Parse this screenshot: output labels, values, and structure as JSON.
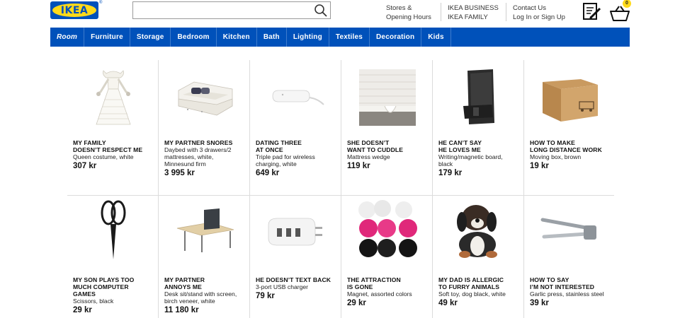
{
  "header": {
    "logo_text": "IKEA",
    "logo_reg": "®",
    "search_placeholder": "",
    "links": [
      {
        "line1": "Stores &",
        "line2": "Opening Hours"
      },
      {
        "line1": "IKEA BUSINESS",
        "line2": "IKEA FAMILY"
      },
      {
        "line1": "Contact Us",
        "line2": "Log In or Sign Up"
      }
    ],
    "cart_count": "0"
  },
  "nav": {
    "items": [
      "Room",
      "Furniture",
      "Storage",
      "Bedroom",
      "Kitchen",
      "Bath",
      "Lighting",
      "Textiles",
      "Decoration",
      "Kids"
    ]
  },
  "products": [
    {
      "head1": "MY FAMILY",
      "head2": "DOESN’T RESPECT ME",
      "desc1": "Queen costume, white",
      "desc2": "",
      "price": "307 kr",
      "icon": "queen-costume-icon"
    },
    {
      "head1": "MY PARTNER SNORES",
      "head2": "",
      "desc1": "Daybed with 3 drawers/2",
      "desc2": "mattresses, white,",
      "desc3": "Minnesund firm",
      "price": "3 995 kr",
      "icon": "daybed-icon"
    },
    {
      "head1": "DATING THREE",
      "head2": "AT ONCE",
      "desc1": "Triple pad for wireless",
      "desc2": "charging, white",
      "price": "649 kr",
      "icon": "charging-pad-icon"
    },
    {
      "head1": "SHE DOESN’T",
      "head2": "WANT TO CUDDLE",
      "desc1": "Mattress wedge",
      "desc2": "",
      "price": "119 kr",
      "icon": "mattress-wedge-icon"
    },
    {
      "head1": "HE CAN’T SAY",
      "head2": "HE LOVES ME",
      "desc1": "Writing/magnetic board,",
      "desc2": "black",
      "price": "179 kr",
      "icon": "magnetic-board-icon"
    },
    {
      "head1": "HOW TO MAKE",
      "head2": "LONG DISTANCE WORK",
      "desc1": "Moving box, brown",
      "desc2": "",
      "price": "19 kr",
      "icon": "moving-box-icon"
    },
    {
      "head1": "MY SON PLAYS TOO",
      "head2": "MUCH COMPUTER",
      "head3": "GAMES",
      "desc1": "Scissors, black",
      "desc2": "",
      "price": "29 kr",
      "icon": "scissors-icon"
    },
    {
      "head1": "MY PARTNER",
      "head2": "ANNOYS ME",
      "desc1": "Desk sit/stand with screen,",
      "desc2": "birch veneer, white",
      "price": "11 180 kr",
      "icon": "desk-icon"
    },
    {
      "head1": "HE DOESN’T TEXT BACK",
      "head2": "",
      "desc1": "3-port USB charger",
      "desc2": "",
      "price": "79 kr",
      "icon": "usb-charger-icon"
    },
    {
      "head1": "THE ATTRACTION",
      "head2": "IS GONE",
      "desc1": "Magnet, assorted colors",
      "desc2": "",
      "price": "29 kr",
      "icon": "magnets-icon"
    },
    {
      "head1": "MY DAD IS ALLERGIC",
      "head2": "TO FURRY ANIMALS",
      "desc1": "Soft toy, dog black, white",
      "desc2": "",
      "price": "49 kr",
      "icon": "soft-toy-dog-icon"
    },
    {
      "head1": "HOW TO SAY",
      "head2": "I’M NOT INTERESTED",
      "desc1": "Garlic press, stainless steel",
      "desc2": "",
      "price": "39 kr",
      "icon": "garlic-press-icon"
    }
  ],
  "colors": {
    "brand_blue": "#0051ba",
    "brand_yellow": "#ffda1a"
  }
}
